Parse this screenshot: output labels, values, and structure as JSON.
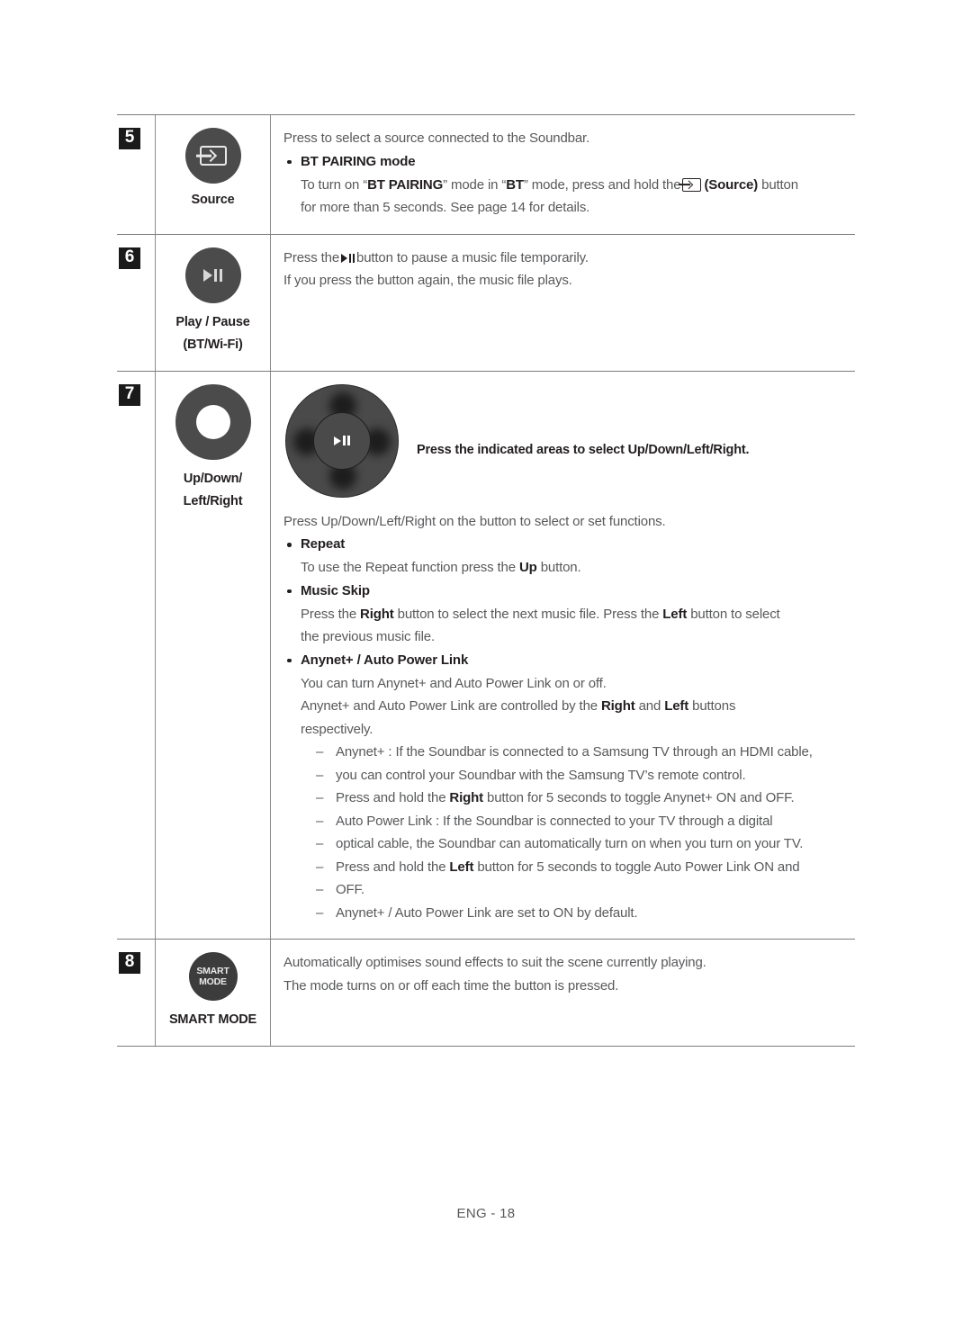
{
  "footer": {
    "text": "ENG - 18"
  },
  "rows": [
    {
      "number": "5",
      "icon_name": "source-button",
      "icon_label": "Source",
      "icon_label2": "",
      "body": {
        "intro": "Press to select a source connected to the Soundbar.",
        "bullet": "BT PAIRING mode",
        "sub_line1_a": "To turn on “",
        "sub_line1_b": "BT PAIRING",
        "sub_line1_c": "” mode in “",
        "sub_line1_d": "BT",
        "sub_line1_e": "” mode, press and hold the",
        "sub_line1_f": "(Source)",
        "sub_line1_g": "button",
        "sub_line2": "for more than 5 seconds. See page 14 for details."
      }
    },
    {
      "number": "6",
      "icon_name": "play-pause-button",
      "icon_label": "Play / Pause",
      "icon_label2": "(BT/Wi-Fi)",
      "body": {
        "line1_a": "Press the",
        "line1_b": "button to pause a music file temporarily.",
        "line2": "If you press the button again, the music file plays."
      }
    },
    {
      "number": "7",
      "icon_name": "up-down-left-right-ring",
      "icon_label": "Up/Down/",
      "icon_label2": "Left/Right",
      "body": {
        "diagram_caption": "Press the indicated areas to select Up/Down/Left/Right.",
        "intro": "Press Up/Down/Left/Right on the button to select or set functions.",
        "bullet_repeat": "Repeat",
        "repeat_text_a": "To use the Repeat function press the",
        "repeat_text_b": "Up",
        "repeat_text_c": "button.",
        "bullet_music_skip": "Music Skip",
        "skip_a": "Press the",
        "skip_b": "Right",
        "skip_c": "button to select the next music file. Press the",
        "skip_d": "Left",
        "skip_e": "button to select",
        "skip_f": "the previous music file.",
        "bullet_anynet": "Anynet+ / Auto Power Link",
        "anynet_l1": "You can turn Anynet+ and Auto Power Link on or off.",
        "anynet_l2_a": "Anynet+ and Auto Power Link are controlled by the",
        "anynet_l2_b": "Right",
        "anynet_l2_c": "and",
        "anynet_l2_d": "Left",
        "anynet_l2_e": "buttons",
        "anynet_l3": "respectively.",
        "dash1_l1": "Anynet+ : If the Soundbar is connected to a Samsung TV through an HDMI cable,",
        "dash1_l2": "you can control your Soundbar with the Samsung TV’s remote control.",
        "dash1_l3_a": "Press and hold the",
        "dash1_l3_b": "Right",
        "dash1_l3_c": "button for 5 seconds to toggle Anynet+ ON and OFF.",
        "dash2_l1": "Auto Power Link : If the Soundbar is connected to your TV through a digital",
        "dash2_l2": "optical cable, the Soundbar can automatically turn on when you turn on your TV.",
        "dash2_l3_a": "Press and hold the",
        "dash2_l3_b": "Left",
        "dash2_l3_c": "button for 5 seconds to toggle Auto Power Link ON and",
        "dash2_l4": "OFF.",
        "dash3": "Anynet+ / Auto Power Link are set to ON by default."
      }
    },
    {
      "number": "8",
      "icon_name": "smart-mode-button",
      "icon_label": "SMART MODE",
      "icon_label2": "",
      "button_text_line1": "SMART",
      "button_text_line2": "MODE",
      "body": {
        "line1": "Automatically optimises sound effects to suit the scene currently playing.",
        "line2": "The mode turns on or off each time the button is pressed."
      }
    }
  ],
  "colors": {
    "text": "#58595b",
    "heading": "#231f20",
    "button_fill": "#4b4b4b",
    "rule": "#7c7c7c"
  }
}
